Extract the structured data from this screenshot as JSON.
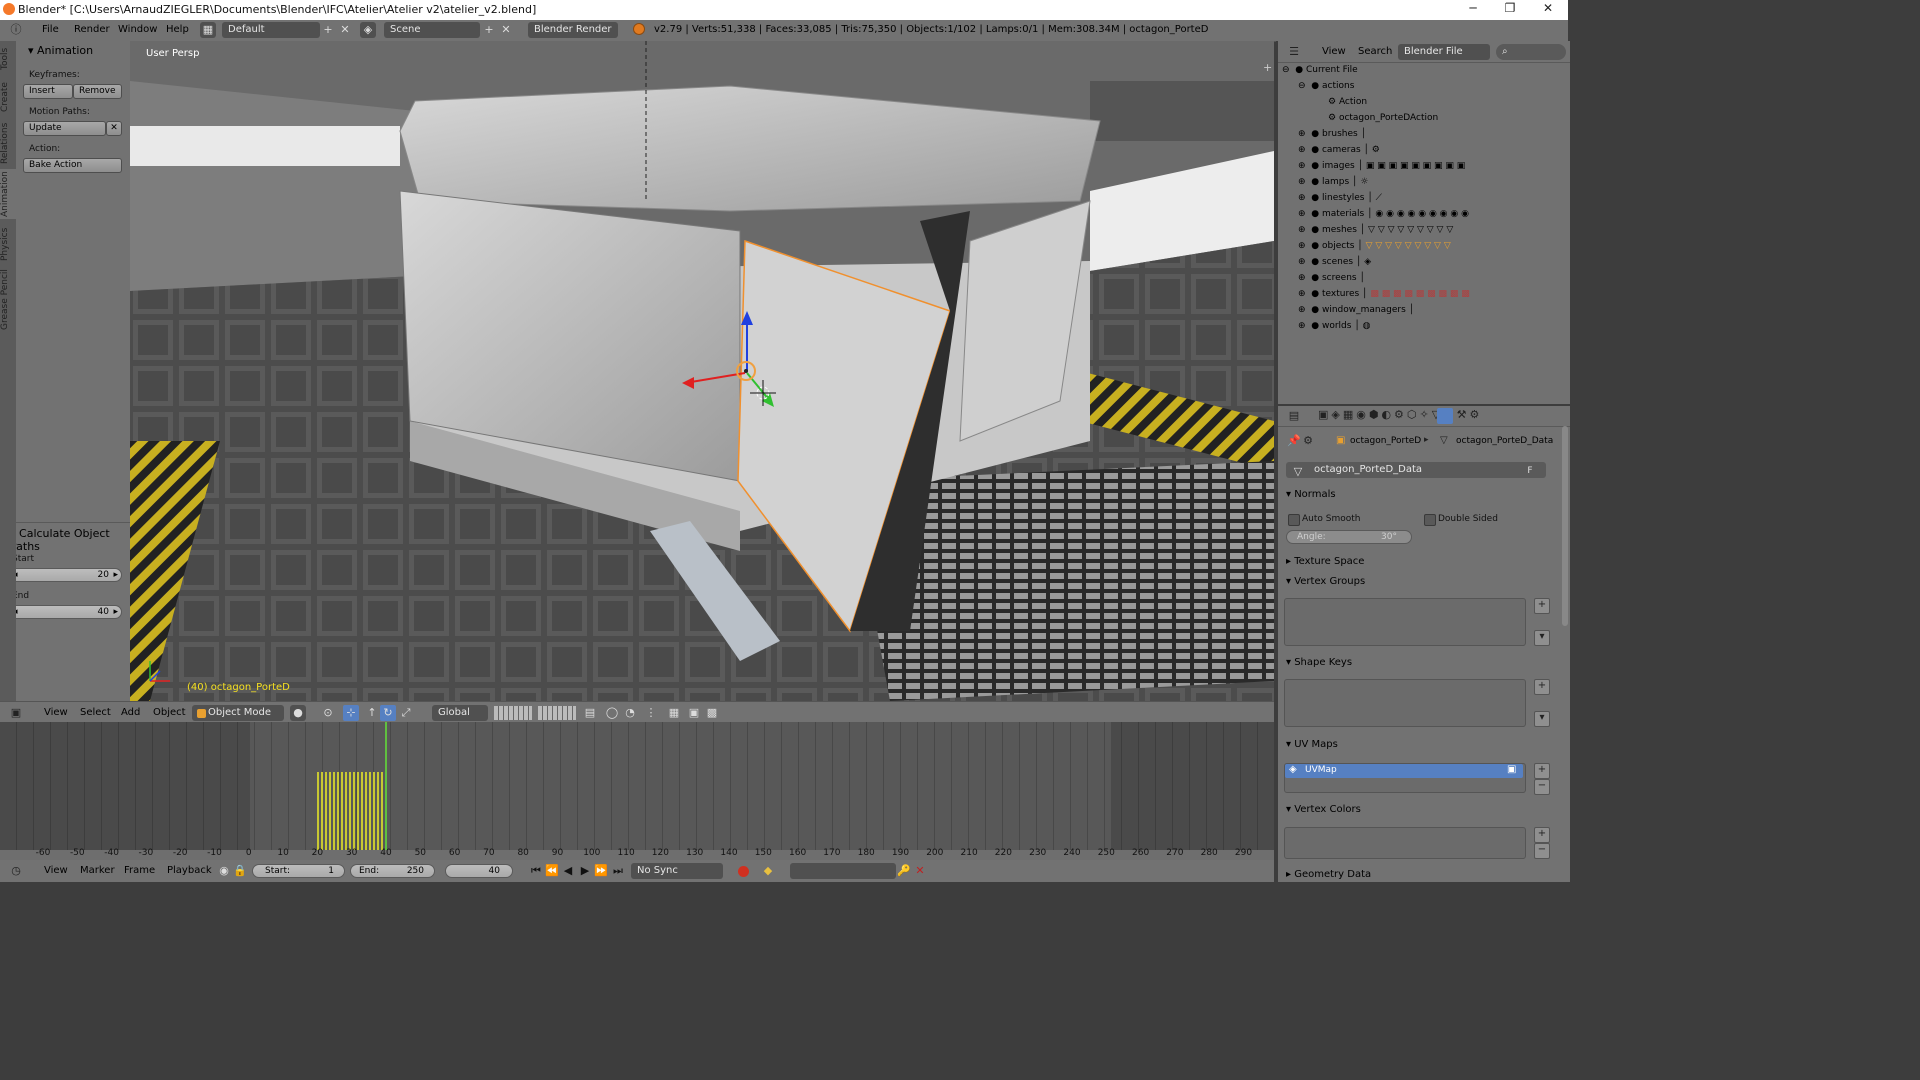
{
  "window": {
    "title": "Blender* [C:\\Users\\ArnaudZIEGLER\\Documents\\Blender\\IFC\\Atelier\\Atelier v2\\atelier_v2.blend]",
    "minimize": "─",
    "maximize": "❐",
    "close": "✕"
  },
  "info_header": {
    "menus": [
      "File",
      "Render",
      "Window",
      "Help"
    ],
    "layout": "Default",
    "scene": "Scene",
    "engine": "Blender Render",
    "stats": "v2.79 | Verts:51,338 | Faces:33,085 | Tris:75,350 | Objects:1/102 | Lamps:0/1 | Mem:308.34M | octagon_PorteD"
  },
  "toolshelf": {
    "tabs": [
      "Tools",
      "Create",
      "Relations",
      "Animation",
      "Physics",
      "Grease Pencil"
    ],
    "panel_title": "Animation",
    "keyframes_label": "Keyframes:",
    "insert": "Insert",
    "remove": "Remove",
    "motion_paths_label": "Motion Paths:",
    "update": "Update",
    "action_label": "Action:",
    "bake_action": "Bake Action",
    "operator_title": "Calculate Object Paths",
    "start_label": "Start",
    "start_value": "20",
    "end_label": "End",
    "end_value": "40"
  },
  "viewport": {
    "view_label": "User Persp",
    "object_label": "(40) octagon_PorteD"
  },
  "view3d_header": {
    "menus": [
      "View",
      "Select",
      "Add",
      "Object"
    ],
    "mode": "Object Mode",
    "orientation": "Global"
  },
  "timeline": {
    "ruler": [
      "-60",
      "-50",
      "-40",
      "-30",
      "-20",
      "-10",
      "0",
      "10",
      "20",
      "30",
      "40",
      "50",
      "60",
      "70",
      "80",
      "90",
      "100",
      "110",
      "120",
      "130",
      "140",
      "150",
      "160",
      "170",
      "180",
      "190",
      "200",
      "210",
      "220",
      "230",
      "240",
      "250",
      "260",
      "270",
      "280",
      "290"
    ],
    "menus": [
      "View",
      "Marker",
      "Frame",
      "Playback"
    ],
    "start_label": "Start:",
    "start_value": "1",
    "end_label": "End:",
    "end_value": "250",
    "current_frame": "40",
    "sync": "No Sync"
  },
  "outliner": {
    "menus": [
      "View",
      "Search"
    ],
    "display": "Blender File",
    "root": "Current File",
    "items": [
      {
        "label": "actions",
        "children": [
          "Action",
          "octagon_PorteDAction"
        ]
      },
      {
        "label": "brushes"
      },
      {
        "label": "cameras"
      },
      {
        "label": "images"
      },
      {
        "label": "lamps"
      },
      {
        "label": "linestyles"
      },
      {
        "label": "materials"
      },
      {
        "label": "meshes"
      },
      {
        "label": "objects"
      },
      {
        "label": "scenes"
      },
      {
        "label": "screens"
      },
      {
        "label": "textures"
      },
      {
        "label": "window_managers"
      },
      {
        "label": "worlds"
      }
    ]
  },
  "properties": {
    "breadcrumb_object": "octagon_PorteD",
    "breadcrumb_data": "octagon_PorteD_Data",
    "datablock_name": "octagon_PorteD_Data",
    "fake_user": "F",
    "normals": "Normals",
    "auto_smooth": "Auto Smooth",
    "double_sided": "Double Sided",
    "angle_label": "Angle:",
    "angle_value": "30°",
    "texture_space": "Texture Space",
    "vertex_groups": "Vertex Groups",
    "shape_keys": "Shape Keys",
    "uv_maps": "UV Maps",
    "uv_map_item": "UVMap",
    "vertex_colors": "Vertex Colors",
    "geometry_data": "Geometry Data"
  },
  "colors": {
    "selection": "#5680c2",
    "outline": "#f0902e",
    "keyframes": "#c8c832",
    "current_frame": "#60c040"
  }
}
